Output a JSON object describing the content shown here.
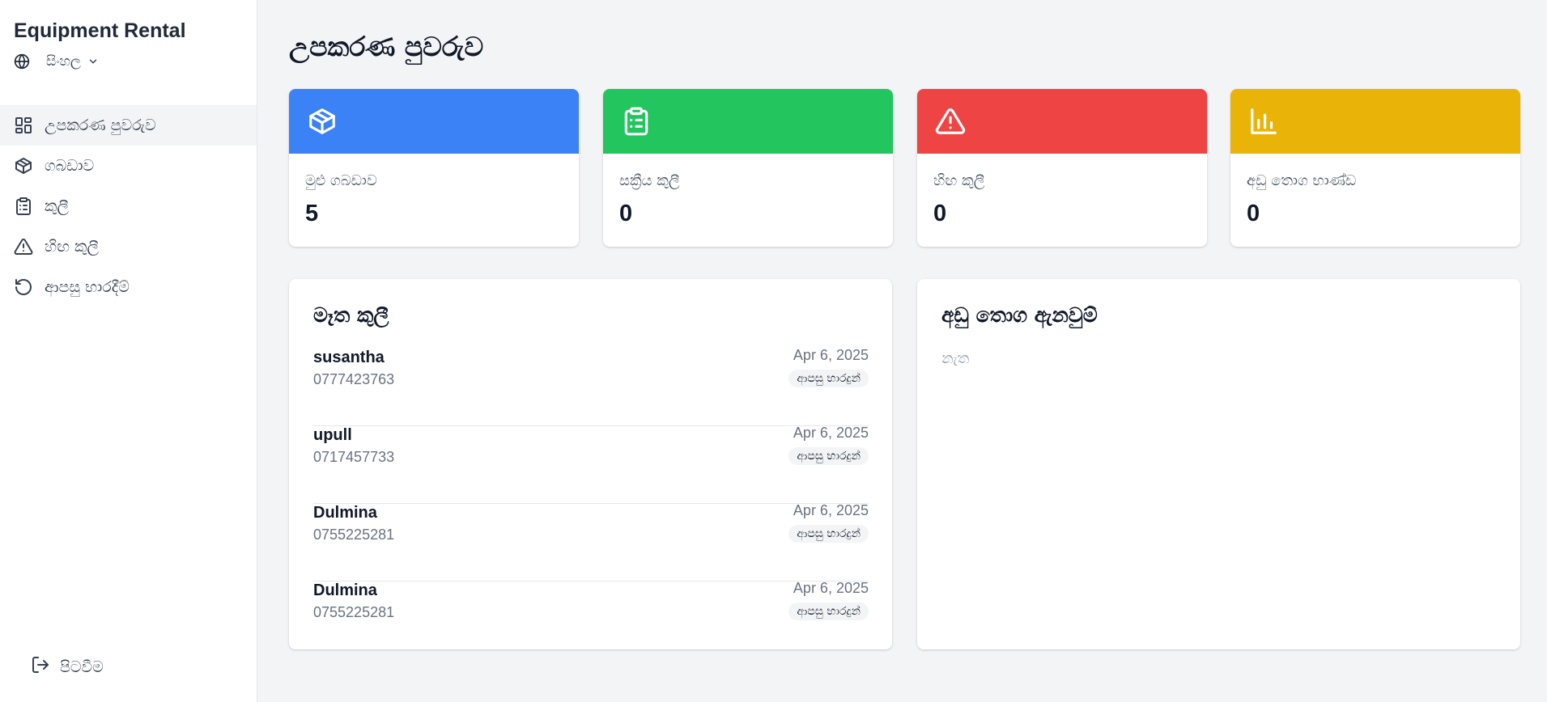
{
  "sidebar": {
    "brand": "Equipment Rental",
    "language": "සිංහල",
    "items": [
      {
        "label": "උපකරණ පුවරුව",
        "icon": "dashboard-icon"
      },
      {
        "label": "ගබඩාව",
        "icon": "package-icon"
      },
      {
        "label": "කුලී",
        "icon": "clipboard-icon"
      },
      {
        "label": "හිඟ කුලී",
        "icon": "warning-icon"
      },
      {
        "label": "ආපසු භාරදීම්",
        "icon": "rotate-ccw-icon"
      }
    ],
    "logout": "පිටවීම"
  },
  "page": {
    "title": "උපකරණ පුවරුව"
  },
  "stats": [
    {
      "label": "මුළු ගබඩාව",
      "value": "5",
      "color": "#3b82f6",
      "icon": "package-icon"
    },
    {
      "label": "සක්‍රීය කුලී",
      "value": "0",
      "color": "#22c55e",
      "icon": "clipboard-icon"
    },
    {
      "label": "හිඟ කුලී",
      "value": "0",
      "color": "#ef4444",
      "icon": "warning-icon"
    },
    {
      "label": "අඩු තොග භාණ්ඩ",
      "value": "0",
      "color": "#eab308",
      "icon": "bar-chart-icon"
    }
  ],
  "recent": {
    "title": "මෑත කුලී",
    "rows": [
      {
        "name": "susantha",
        "phone": "0777423763",
        "date": "Apr 6, 2025",
        "status": "ආපසු භාරදුන්"
      },
      {
        "name": "upull",
        "phone": "0717457733",
        "date": "Apr 6, 2025",
        "status": "ආපසු භාරදුන්"
      },
      {
        "name": "Dulmina",
        "phone": "0755225281",
        "date": "Apr 6, 2025",
        "status": "ආපසු භාරදුන්"
      },
      {
        "name": "Dulmina",
        "phone": "0755225281",
        "date": "Apr 6, 2025",
        "status": "ආපසු භාරදුන්"
      }
    ]
  },
  "lowstock": {
    "title": "අඩු තොග ඇනවුම්",
    "empty": "නැත"
  }
}
